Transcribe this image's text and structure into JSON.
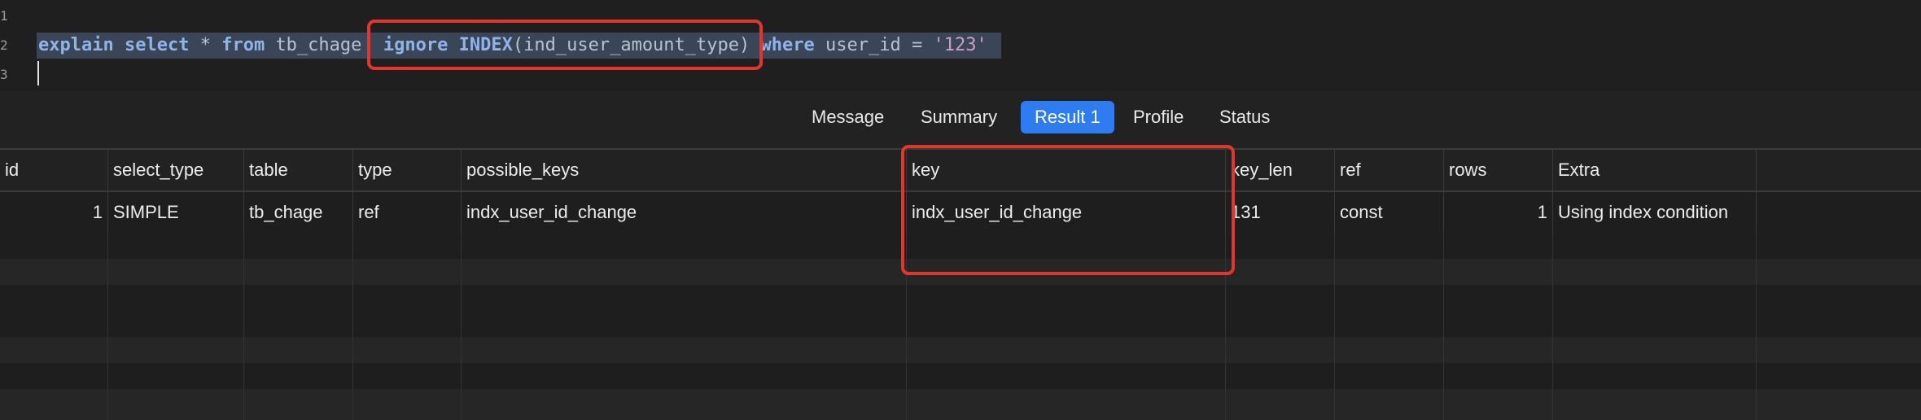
{
  "editor": {
    "line_numbers": [
      "1",
      "2",
      "3"
    ],
    "sql": {
      "kw_explain": "explain",
      "kw_select": "select",
      "star": "*",
      "kw_from": "from",
      "table": "tb_chage",
      "kw_ignore": "ignore",
      "kw_index": "INDEX",
      "index_arg": "(ind_user_amount_type)",
      "kw_where": "where",
      "condition": "user_id =",
      "value": "'123'"
    }
  },
  "tabs": [
    {
      "label": "Message",
      "active": false
    },
    {
      "label": "Summary",
      "active": false
    },
    {
      "label": "Result 1",
      "active": true
    },
    {
      "label": "Profile",
      "active": false
    },
    {
      "label": "Status",
      "active": false
    }
  ],
  "grid": {
    "columns": [
      "id",
      "select_type",
      "table",
      "type",
      "possible_keys",
      "key",
      "key_len",
      "ref",
      "rows",
      "Extra"
    ],
    "rows": [
      [
        "1",
        "SIMPLE",
        "tb_chage",
        "ref",
        "indx_user_id_change",
        "indx_user_id_change",
        "131",
        "const",
        "1",
        "Using index condition"
      ]
    ]
  },
  "colors": {
    "highlight": "#e0362c",
    "active_tab": "#2e7cf0",
    "selection": "#3a4657"
  }
}
